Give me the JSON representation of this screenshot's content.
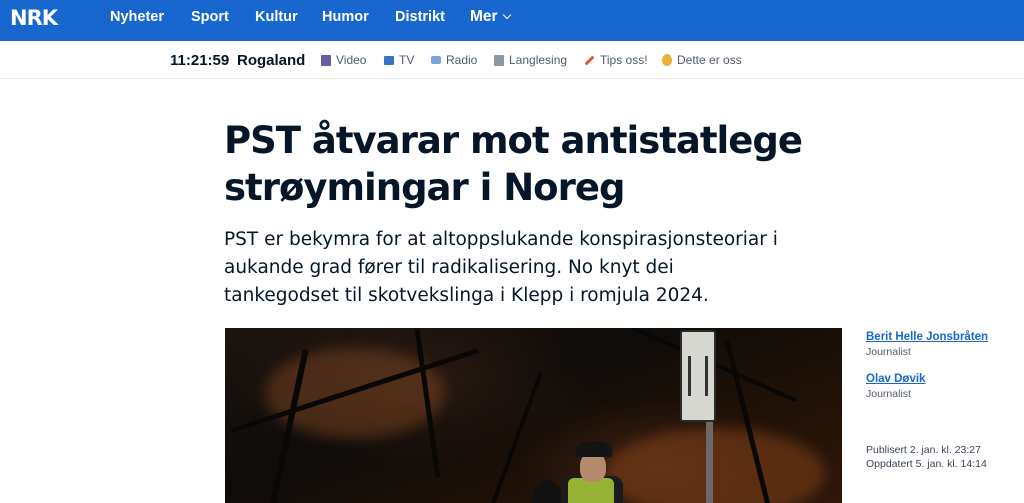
{
  "topbar": {
    "logo": "NRK",
    "nav": [
      "Nyheter",
      "Sport",
      "Kultur",
      "Humor",
      "Distrikt"
    ],
    "more_label": "Mer"
  },
  "subbar": {
    "time": "11:21:59",
    "region": "Rogaland",
    "services": [
      {
        "label": "Video",
        "icon": "video-icon"
      },
      {
        "label": "TV",
        "icon": "tv-icon"
      },
      {
        "label": "Radio",
        "icon": "radio-icon"
      },
      {
        "label": "Langlesing",
        "icon": "longread-icon"
      },
      {
        "label": "Tips oss!",
        "icon": "pencil-icon"
      },
      {
        "label": "Dette er oss",
        "icon": "hand-icon"
      }
    ]
  },
  "article": {
    "headline": "PST åtvarar mot antistatlege strøymingar i Noreg",
    "lead": "PST er bekymra for at altoppslukande konspirasjonsteoriar i aukande grad fører til radikalisering. No knyt dei tankegodset til skotvekslinga i Klepp i romjula 2024."
  },
  "byline": {
    "authors": [
      {
        "name": "Berit Helle Jonsbråten",
        "role": "Journalist"
      },
      {
        "name": "Olav Døvik",
        "role": "Journalist"
      }
    ],
    "published": "Publisert 2. jan. kl. 23:27",
    "updated": "Oppdatert 5. jan. kl. 14:14"
  },
  "colors": {
    "brand_blue": "#1767ce",
    "text_dark": "#061629",
    "link_blue": "#1767ce"
  }
}
